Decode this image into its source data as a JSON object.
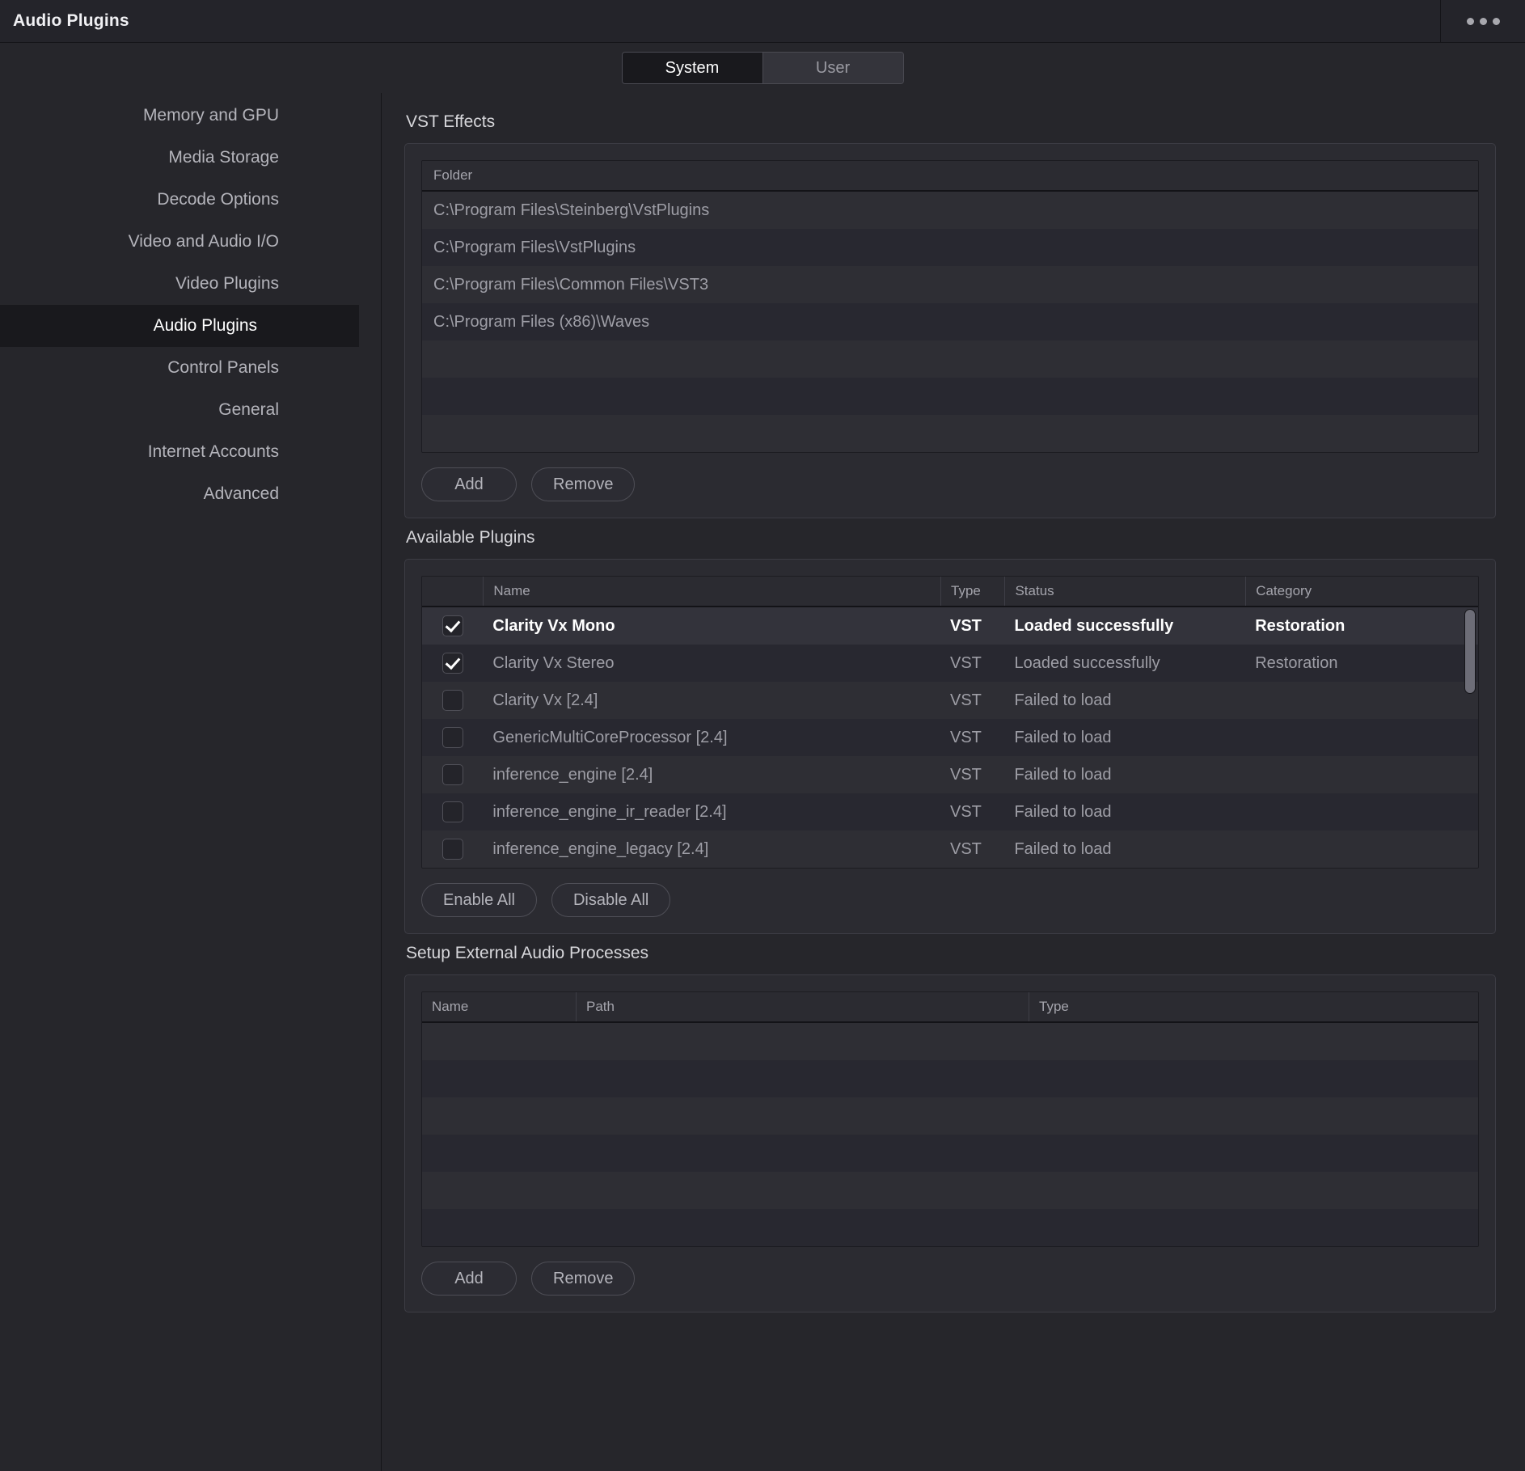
{
  "window": {
    "title": "Audio Plugins",
    "menu_icon": "ellipsis-icon"
  },
  "tabs": [
    {
      "label": "System",
      "active": true
    },
    {
      "label": "User",
      "active": false
    }
  ],
  "sidebar": {
    "items": [
      {
        "label": "Memory and GPU",
        "active": false
      },
      {
        "label": "Media Storage",
        "active": false
      },
      {
        "label": "Decode Options",
        "active": false
      },
      {
        "label": "Video and Audio I/O",
        "active": false
      },
      {
        "label": "Video Plugins",
        "active": false
      },
      {
        "label": "Audio Plugins",
        "active": true
      },
      {
        "label": "Control Panels",
        "active": false
      },
      {
        "label": "General",
        "active": false
      },
      {
        "label": "Internet Accounts",
        "active": false
      },
      {
        "label": "Advanced",
        "active": false
      }
    ]
  },
  "vst_effects": {
    "title": "VST Effects",
    "columns": [
      "Folder"
    ],
    "rows": [
      "C:\\Program Files\\Steinberg\\VstPlugins",
      "C:\\Program Files\\VstPlugins",
      "C:\\Program Files\\Common Files\\VST3",
      "C:\\Program Files (x86)\\Waves"
    ],
    "empty_row_count": 3,
    "buttons": {
      "add": "Add",
      "remove": "Remove"
    }
  },
  "available_plugins": {
    "title": "Available Plugins",
    "columns": [
      "",
      "Name",
      "Type",
      "Status",
      "Category"
    ],
    "rows": [
      {
        "checked": true,
        "name": "Clarity Vx Mono",
        "type": "VST",
        "status": "Loaded successfully",
        "category": "Restoration",
        "selected": true
      },
      {
        "checked": true,
        "name": "Clarity Vx Stereo",
        "type": "VST",
        "status": "Loaded successfully",
        "category": "Restoration",
        "selected": false
      },
      {
        "checked": false,
        "name": "Clarity Vx [2.4]",
        "type": "VST",
        "status": "Failed to load",
        "category": "",
        "selected": false
      },
      {
        "checked": false,
        "name": "GenericMultiCoreProcessor [2.4]",
        "type": "VST",
        "status": "Failed to load",
        "category": "",
        "selected": false
      },
      {
        "checked": false,
        "name": "inference_engine [2.4]",
        "type": "VST",
        "status": "Failed to load",
        "category": "",
        "selected": false
      },
      {
        "checked": false,
        "name": "inference_engine_ir_reader [2.4]",
        "type": "VST",
        "status": "Failed to load",
        "category": "",
        "selected": false
      },
      {
        "checked": false,
        "name": "inference_engine_legacy [2.4]",
        "type": "VST",
        "status": "Failed to load",
        "category": "",
        "selected": false
      }
    ],
    "scrollbar": {
      "visible": true,
      "thumb_position": "top"
    },
    "buttons": {
      "enable_all": "Enable All",
      "disable_all": "Disable All"
    }
  },
  "external_processes": {
    "title": "Setup External Audio Processes",
    "columns": [
      "Name",
      "Path",
      "Type"
    ],
    "rows": [],
    "empty_row_count": 6,
    "buttons": {
      "add": "Add",
      "remove": "Remove"
    }
  },
  "colors": {
    "window_bg": "#26262b",
    "panel_bg": "#2b2b31",
    "active_highlight": "#19191d",
    "text_primary": "#ffffff",
    "text_secondary": "#9e9ea6",
    "border": "#3c3c44"
  }
}
